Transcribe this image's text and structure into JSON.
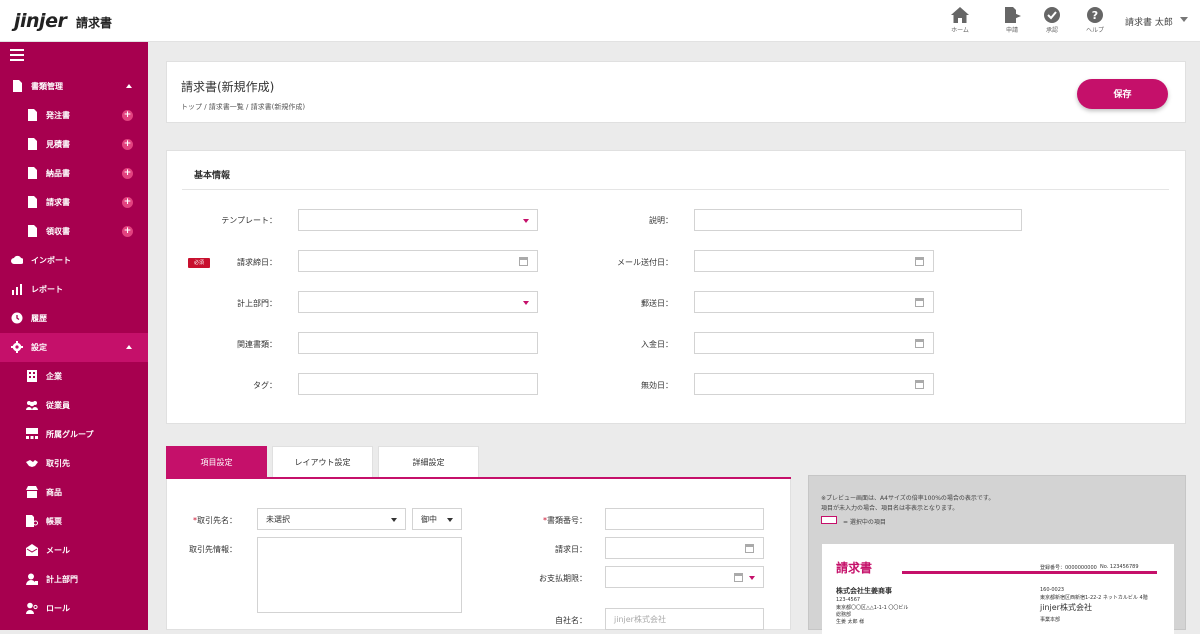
{
  "header": {
    "logo": "jinjer",
    "product": "請求書",
    "nav": [
      {
        "label": "ホーム",
        "icon": "home-icon"
      },
      {
        "label": "申請",
        "icon": "request-icon"
      },
      {
        "label": "承認",
        "icon": "approval-icon"
      },
      {
        "label": "ヘルプ",
        "icon": "help-icon"
      }
    ],
    "user": "請求書 太郎"
  },
  "sidebar": {
    "doc_group": {
      "label": "書類管理"
    },
    "docs": [
      {
        "label": "発注書"
      },
      {
        "label": "見積書"
      },
      {
        "label": "納品書"
      },
      {
        "label": "請求書"
      },
      {
        "label": "領収書"
      }
    ],
    "import": "インポート",
    "report": "レポート",
    "history": "履歴",
    "settings": "設定",
    "settings_items": [
      {
        "label": "企業"
      },
      {
        "label": "従業員"
      },
      {
        "label": "所属グループ"
      },
      {
        "label": "取引先"
      },
      {
        "label": "商品"
      },
      {
        "label": "帳票"
      },
      {
        "label": "メール"
      },
      {
        "label": "計上部門"
      },
      {
        "label": "ロール"
      }
    ]
  },
  "page": {
    "title": "請求書(新規作成)",
    "breadcrumb": "トップ / 請求書一覧 / 請求書(新規作成)",
    "save_label": "保存"
  },
  "basic": {
    "title": "基本情報",
    "required_badge": "必須",
    "left": [
      {
        "label": "テンプレート："
      },
      {
        "label": "請求締日："
      },
      {
        "label": "計上部門："
      },
      {
        "label": "関連書類："
      },
      {
        "label": "タグ："
      }
    ],
    "right": [
      {
        "label": "説明："
      },
      {
        "label": "メール送付日："
      },
      {
        "label": "郵送日："
      },
      {
        "label": "入金日："
      },
      {
        "label": "無効日："
      }
    ]
  },
  "tabs": [
    {
      "label": "項目設定"
    },
    {
      "label": "レイアウト設定"
    },
    {
      "label": "詳細設定"
    }
  ],
  "items": {
    "client_label": "取引先名：",
    "client_value": "未選択",
    "honorific": "御中",
    "client_info_label": "取引先情報：",
    "doc_no_label": "書類番号：",
    "invoice_date_label": "請求日：",
    "due_label": "お支払期限：",
    "company_label": "自社名：",
    "company_placeholder": "jinjer株式会社",
    "required_mark": "*"
  },
  "preview": {
    "note1": "※プレビュー画面は、A4サイズの倍率100%の場合の表示です。",
    "note2": "項目が未入力の場合、項目名は非表示となります。",
    "legend": "= 選択中の項目",
    "doc_title": "請求書",
    "doc_number": "No. 123456789",
    "registration": "登録番号：0000000000",
    "client_name": "株式会社生姜商事",
    "client_addr1": "123-4567",
    "client_addr2": "東京都〇〇区△△1-1-1 〇〇ビル",
    "client_addr3": "総務部",
    "client_addr4": "生姜 太郎 様",
    "own_postal": "160-0023",
    "own_addr": "東京都新宿区西新宿1-22-2 ネットカルビル 4階",
    "own_name": "jinjer株式会社",
    "own_dept": "事業本部"
  }
}
